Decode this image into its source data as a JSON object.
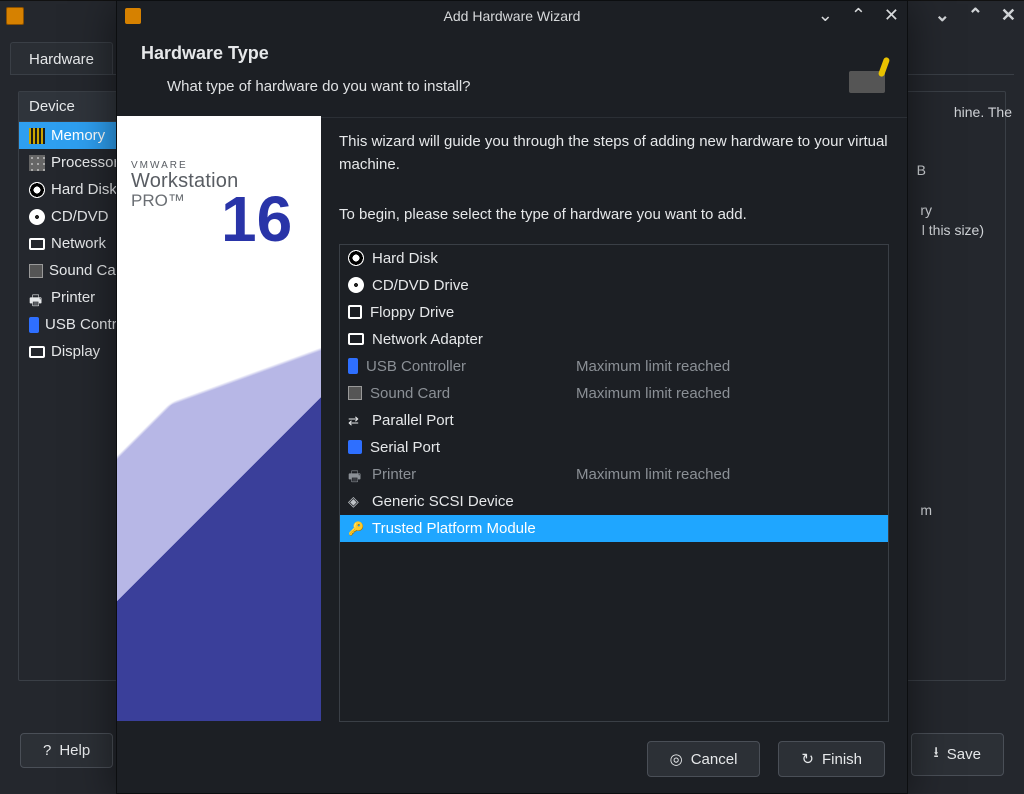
{
  "back": {
    "tab_hardware": "Hardware",
    "device_header": "Device",
    "devices": [
      {
        "label": "Memory",
        "selected": true
      },
      {
        "label": "Processors"
      },
      {
        "label": "Hard Disk"
      },
      {
        "label": "CD/DVD"
      },
      {
        "label": "Network"
      },
      {
        "label": "Sound Card"
      },
      {
        "label": "Printer"
      },
      {
        "label": "USB Controller"
      },
      {
        "label": "Display"
      }
    ],
    "right_text1": "hine. The",
    "right_text2": "B",
    "right_text3": "ry",
    "right_text4": "l this size)",
    "right_text5": "m",
    "btn_help": "Help",
    "btn_save": "Save"
  },
  "wizard": {
    "title": "Add Hardware Wizard",
    "header_title": "Hardware Type",
    "header_sub": "What type of hardware do you want to install?",
    "brand_vm": "VMWARE",
    "brand_wk": "Workstation",
    "brand_pro": "PRO™",
    "brand_num": "16",
    "intro1": "This wizard will guide you through the steps of adding new hardware to your virtual machine.",
    "intro2": "To begin, please select the type of hardware you want to add.",
    "rows": [
      {
        "label": "Hard Disk"
      },
      {
        "label": "CD/DVD Drive"
      },
      {
        "label": "Floppy Drive"
      },
      {
        "label": "Network Adapter"
      },
      {
        "label": "USB Controller",
        "note": "Maximum limit reached",
        "disabled": true
      },
      {
        "label": "Sound Card",
        "note": "Maximum limit reached",
        "disabled": true
      },
      {
        "label": "Parallel Port"
      },
      {
        "label": "Serial Port"
      },
      {
        "label": "Printer",
        "note": "Maximum limit reached",
        "disabled": true
      },
      {
        "label": "Generic SCSI Device"
      },
      {
        "label": "Trusted Platform Module",
        "selected": true
      }
    ],
    "btn_cancel": "Cancel",
    "btn_finish": "Finish"
  }
}
